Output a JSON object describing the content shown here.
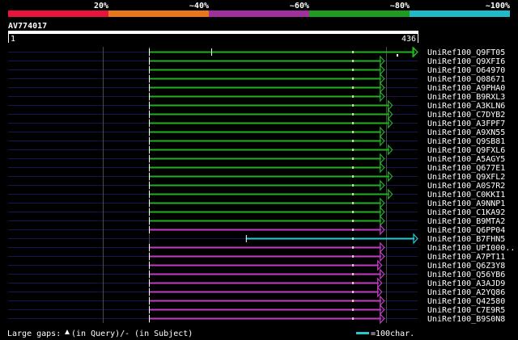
{
  "identity_scale": {
    "segments": [
      {
        "label": "20%",
        "color": "#e8143c"
      },
      {
        "label": "~40%",
        "color": "#e8771c"
      },
      {
        "label": "~60%",
        "color": "#a0309c"
      },
      {
        "label": "~80%",
        "color": "#1f9c1f"
      },
      {
        "label": "~100%",
        "color": "#1fbcc8"
      }
    ]
  },
  "query": {
    "id": "AV774017",
    "start": "1",
    "end": "436",
    "length": 436
  },
  "colors": {
    "green": "#22b022",
    "magenta": "#c43cc4",
    "cyan": "#28c8d0",
    "gap": "#d8d8b8",
    "grid": "#16164e",
    "vline": "#4a4a4a"
  },
  "hits": [
    {
      "label": "UniRef100_Q9FT05",
      "color": "green",
      "start": 1,
      "end": 436,
      "ext": true
    },
    {
      "label": "UniRef100_Q9XFI6",
      "color": "green",
      "start": 1,
      "end": 382
    },
    {
      "label": "UniRef100_O64970",
      "color": "green",
      "start": 1,
      "end": 382
    },
    {
      "label": "UniRef100_Q08671",
      "color": "green",
      "start": 1,
      "end": 382
    },
    {
      "label": "UniRef100_A9PHA0",
      "color": "green",
      "start": 1,
      "end": 382
    },
    {
      "label": "UniRef100_B9RXL3",
      "color": "green",
      "start": 1,
      "end": 382
    },
    {
      "label": "UniRef100_A3KLN6",
      "color": "green",
      "start": 1,
      "end": 395
    },
    {
      "label": "UniRef100_C7DYB2",
      "color": "green",
      "start": 1,
      "end": 395
    },
    {
      "label": "UniRef100_A3FPF7",
      "color": "green",
      "start": 1,
      "end": 395
    },
    {
      "label": "UniRef100_A9XN55",
      "color": "green",
      "start": 1,
      "end": 382
    },
    {
      "label": "UniRef100_Q9SB81",
      "color": "green",
      "start": 1,
      "end": 382
    },
    {
      "label": "UniRef100_Q9FXL6",
      "color": "green",
      "start": 1,
      "end": 395
    },
    {
      "label": "UniRef100_A5AGY5",
      "color": "green",
      "start": 1,
      "end": 382
    },
    {
      "label": "UniRef100_Q677E1",
      "color": "green",
      "start": 1,
      "end": 382
    },
    {
      "label": "UniRef100_Q9XFL2",
      "color": "green",
      "start": 1,
      "end": 395
    },
    {
      "label": "UniRef100_A0S7R2",
      "color": "green",
      "start": 1,
      "end": 382
    },
    {
      "label": "UniRef100_C0KKI1",
      "color": "green",
      "start": 1,
      "end": 395
    },
    {
      "label": "UniRef100_A9NNP1",
      "color": "green",
      "start": 1,
      "end": 382
    },
    {
      "label": "UniRef100_C1KA92",
      "color": "green",
      "start": 1,
      "end": 382
    },
    {
      "label": "UniRef100_B9MTA2",
      "color": "green",
      "start": 1,
      "end": 382
    },
    {
      "label": "UniRef100_Q6PP04",
      "color": "magenta",
      "start": 1,
      "end": 382
    },
    {
      "label": "UniRef100_B7FHN5",
      "color": "cyan",
      "start": 158,
      "end": 436
    },
    {
      "label": "UniRef100_UPI000..",
      "color": "magenta",
      "start": 1,
      "end": 382
    },
    {
      "label": "UniRef100_A7PT11",
      "color": "magenta",
      "start": 1,
      "end": 382
    },
    {
      "label": "UniRef100_Q6Z3Y8",
      "color": "magenta",
      "start": 1,
      "end": 378
    },
    {
      "label": "UniRef100_Q56YB6",
      "color": "magenta",
      "start": 1,
      "end": 382
    },
    {
      "label": "UniRef100_A3AJD9",
      "color": "magenta",
      "start": 1,
      "end": 378
    },
    {
      "label": "UniRef100_A2YQ86",
      "color": "magenta",
      "start": 1,
      "end": 378
    },
    {
      "label": "UniRef100_Q42580",
      "color": "magenta",
      "start": 1,
      "end": 382
    },
    {
      "label": "UniRef100_C7E9R5",
      "color": "magenta",
      "start": 1,
      "end": 382
    },
    {
      "label": "UniRef100_B9S0N8",
      "color": "magenta",
      "start": 1,
      "end": 382
    }
  ],
  "footer": {
    "gaps_label": "Large gaps:",
    "query_gap_text": "(in Query)/",
    "subject_gap_text": "- (in Subject)",
    "scale_label": "=100char."
  }
}
